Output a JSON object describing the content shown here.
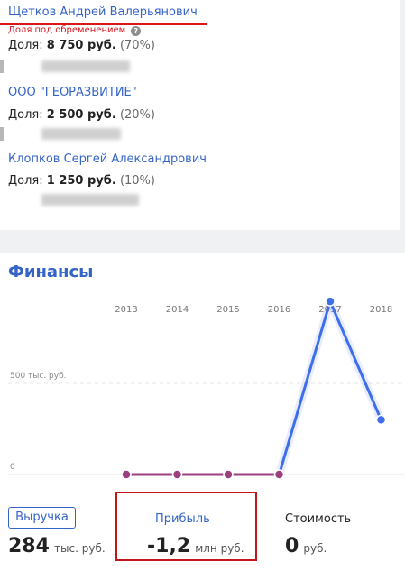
{
  "founders": {
    "items": [
      {
        "name": "Щетков Андрей Валерьянович",
        "note": "Доля под обременением",
        "share_label": "Доля:",
        "share_value": "8 750 руб.",
        "share_pct": "(70%)"
      },
      {
        "name": "ООО \"ГЕОРАЗВИТИЕ\"",
        "share_label": "Доля:",
        "share_value": "2 500 руб.",
        "share_pct": "(20%)"
      },
      {
        "name": "Клопков Сергей Александрович",
        "share_label": "Доля:",
        "share_value": "1 250 руб.",
        "share_pct": "(10%)"
      }
    ],
    "help_glyph": "?"
  },
  "finances": {
    "title": "Финансы",
    "revenue_button": "Выручка",
    "revenue_value": "284",
    "revenue_unit": "тыс. руб.",
    "profit_label": "Прибыль",
    "profit_value": "-1,2",
    "profit_unit": "млн руб.",
    "cost_label": "Стоимость",
    "cost_value": "0",
    "cost_unit": "руб."
  },
  "chart_data": {
    "type": "line",
    "x": [
      "2013",
      "2014",
      "2015",
      "2016",
      "2017",
      "2018"
    ],
    "series": [
      {
        "values": [
          0,
          0,
          0,
          0,
          950,
          300
        ]
      }
    ],
    "y_tick_labels": [
      "500 тыс. руб.",
      "0"
    ],
    "y_ticks": [
      500,
      0
    ],
    "ylim": [
      0,
      1000
    ],
    "grid": "dashed horizontal",
    "colors": {
      "rise": "#3e6ee8",
      "flat": "#9b3f80",
      "grid": "#e4e4e4"
    }
  }
}
